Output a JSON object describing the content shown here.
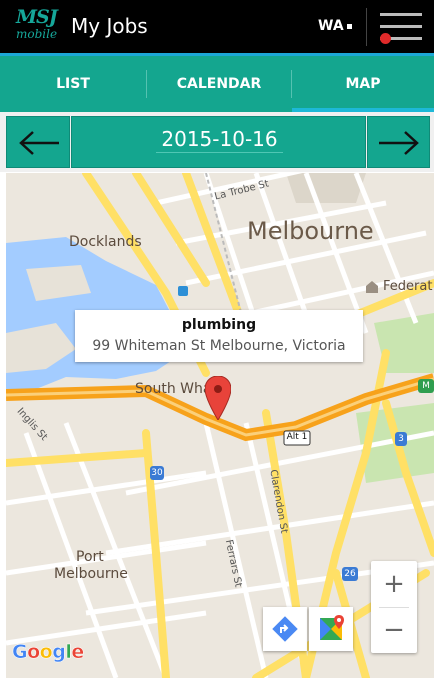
{
  "header": {
    "logo_top": "MSJ",
    "logo_bottom": "mobile",
    "title": "My Jobs",
    "state_selector": "WA",
    "menu_icon": "hamburger-menu-icon"
  },
  "tabs": [
    {
      "label": "LIST",
      "active": false
    },
    {
      "label": "CALENDAR",
      "active": false
    },
    {
      "label": "MAP",
      "active": true
    }
  ],
  "date_nav": {
    "prev_icon": "arrow-left-icon",
    "date": "2015-10-16",
    "next_icon": "arrow-right-icon"
  },
  "map": {
    "popup_title": "plumbing",
    "popup_address": "99 Whiteman St Melbourne, Victoria",
    "labels": {
      "melbourne": "Melbourne",
      "docklands": "Docklands",
      "south_wharf": "South Wha",
      "port_melbourne_1": "Port",
      "port_melbourne_2": "Melbourne",
      "latrobe": "La Trobe St",
      "inglis": "Inglis St",
      "clarendon": "Clarendon St",
      "ferrars": "Ferrars St",
      "federation": "Federat",
      "alt1": "Alt 1",
      "route_30": "30",
      "route_26": "26",
      "route_3": "3",
      "route_m": "M"
    },
    "zoom_in": "+",
    "zoom_out": "−",
    "google_logo": "Google",
    "colors": {
      "accent": "#14a68f",
      "water": "#a3ccff",
      "freeway": "#f7a21b",
      "major_road": "#ffe066",
      "land": "#ece7de",
      "marker": "#e8433a"
    }
  }
}
